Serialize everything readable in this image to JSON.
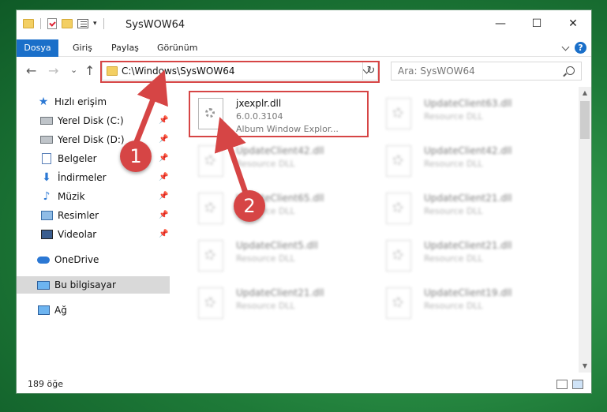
{
  "window": {
    "title": "SysWOW64"
  },
  "ribbon": {
    "tabs": [
      "Dosya",
      "Giriş",
      "Paylaş",
      "Görünüm"
    ],
    "help": "?"
  },
  "nav": {
    "back": "←",
    "forward": "→",
    "recent": "⌄",
    "up": "↑"
  },
  "address": {
    "path": "C:\\Windows\\SysWOW64",
    "refresh": "↻"
  },
  "search": {
    "placeholder": "Ara: SysWOW64"
  },
  "sidebar": {
    "quick_access": "Hızlı erişim",
    "items": [
      "Yerel Disk (C:)",
      "Yerel Disk (D:)",
      "Belgeler",
      "İndirmeler",
      "Müzik",
      "Resimler",
      "Videolar"
    ],
    "onedrive": "OneDrive",
    "this_pc": "Bu bilgisayar",
    "network": "Ağ"
  },
  "files": {
    "highlight": {
      "name": "jxexplr.dll",
      "version": "6.0.0.3104",
      "desc": "Album Window Explor..."
    },
    "left": [
      {
        "name": "UpdateClient42.dll",
        "desc": "Resource DLL"
      },
      {
        "name": "UpdateClient65.dll",
        "desc": "Resource DLL"
      },
      {
        "name": "UpdateClient5.dll",
        "desc": "Resource DLL"
      },
      {
        "name": "UpdateClient21.dll",
        "desc": "Resource DLL"
      }
    ],
    "right": [
      {
        "name": "UpdateClient63.dll",
        "desc": "Resource DLL"
      },
      {
        "name": "UpdateClient42.dll",
        "desc": "Resource DLL"
      },
      {
        "name": "UpdateClient21.dll",
        "desc": "Resource DLL"
      },
      {
        "name": "UpdateClient21.dll",
        "desc": "Resource DLL"
      },
      {
        "name": "UpdateClient19.dll",
        "desc": "Resource DLL"
      }
    ]
  },
  "status": {
    "count": "189 öğe"
  },
  "annotations": {
    "step1": "1",
    "step2": "2"
  },
  "colors": {
    "accent": "#1a6fc9",
    "annotation": "#d64545"
  },
  "winbuttons": {
    "minimize": "—",
    "maximize": "☐",
    "close": "✕"
  }
}
